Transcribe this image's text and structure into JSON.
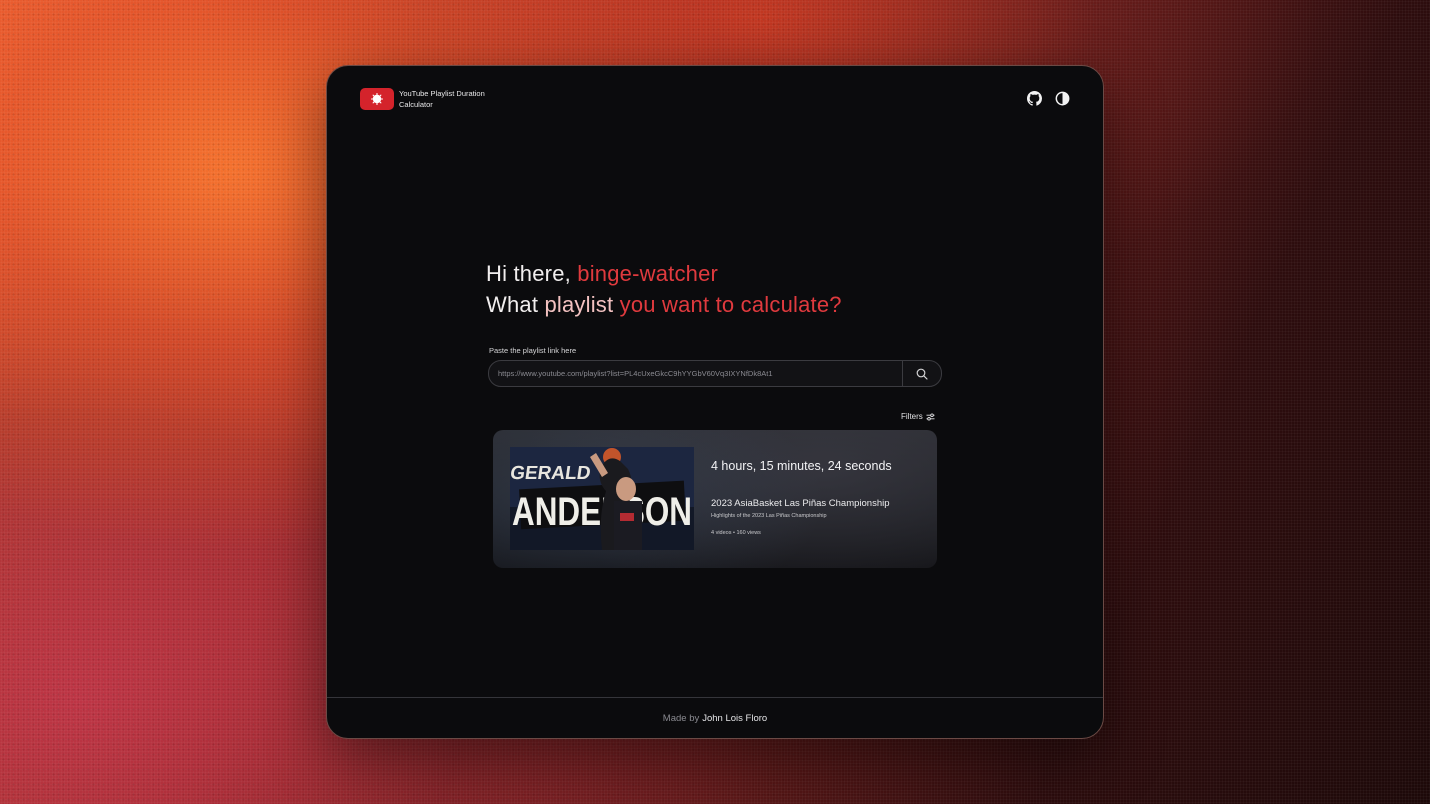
{
  "header": {
    "app_title": "YouTube Playlist Duration Calculator",
    "icons": [
      "github-icon",
      "theme-toggle-icon"
    ]
  },
  "hero": {
    "line1_prefix": "Hi there,",
    "line1_accent": "binge-watcher",
    "line2_what": "What",
    "line2_playlist": "playlist",
    "line2_rest": "you want to calculate?"
  },
  "search": {
    "label": "Paste the playlist link here",
    "value": "https://www.youtube.com/playlist?list=PL4cUxeGkcC9hYYGbV60Vq3IXYNfDk8At1",
    "button_icon": "search-icon"
  },
  "filters": {
    "label": "Filters",
    "icon": "sliders-icon"
  },
  "result": {
    "duration": "4 hours, 15 minutes, 24 seconds",
    "playlist_title": "2023 AsiaBasket Las Piñas Championship",
    "playlist_description": "Highlights of the 2023 Las Piñas Championship",
    "meta": "4 videos • 160 views",
    "thumbnail_text_top": "GERALD",
    "thumbnail_text_bottom": "ANDERSON"
  },
  "footer": {
    "made_by": "Made by",
    "author": "John Lois Floro"
  },
  "colors": {
    "accent_red": "#e03a3e",
    "soft_pink": "#f3c2c1",
    "window_bg": "#0b0b0d",
    "logo_red": "#d4232b"
  }
}
